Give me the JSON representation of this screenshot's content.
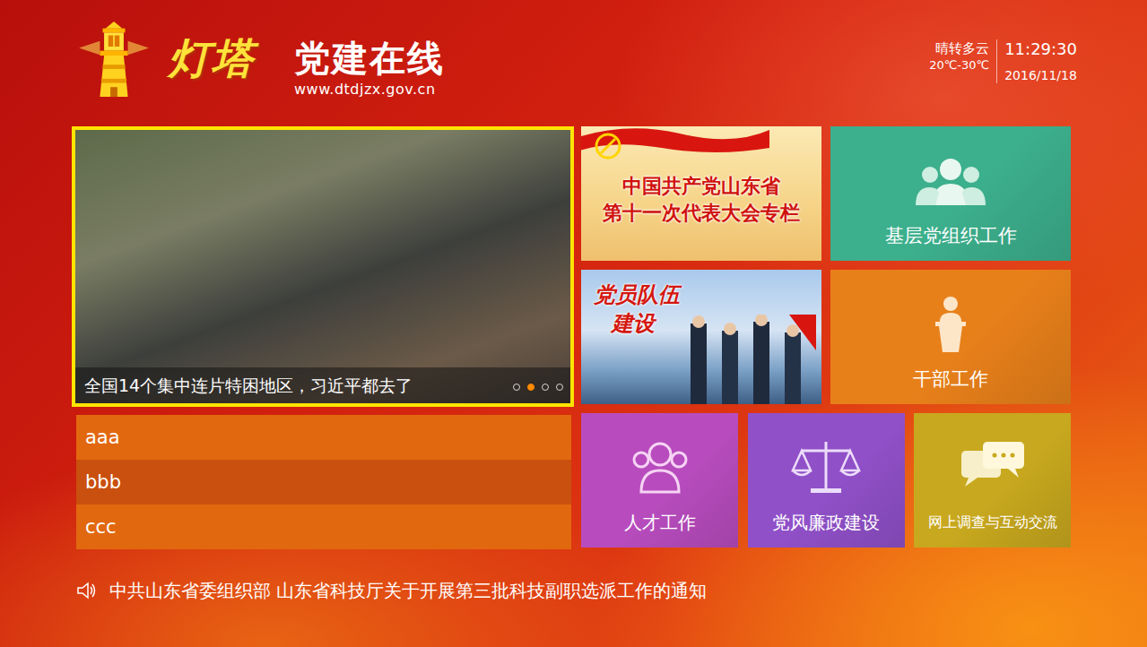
{
  "header": {
    "logo_text": "灯塔",
    "title": "党建在线",
    "url": "www.dtdjzx.gov.cn",
    "weather": "晴转多云",
    "temperature": "20℃-30℃",
    "time": "11:29:30",
    "date": "2016/11/18"
  },
  "carousel": {
    "selected": true,
    "caption": "全国14个集中连片特困地区，习近平都去了",
    "dots": [
      {
        "selected": false
      },
      {
        "selected": true
      },
      {
        "selected": false
      },
      {
        "selected": false
      }
    ]
  },
  "news_list": [
    {
      "title": "aaa"
    },
    {
      "title": "bbb"
    },
    {
      "title": "ccc"
    }
  ],
  "tiles": [
    {
      "kind": "banner",
      "lines": [
        "中国共产党山东省",
        "第十一次代表大会专栏"
      ],
      "selected": false,
      "color": "#f6d58a"
    },
    {
      "kind": "icon",
      "label": "基层党组织工作",
      "selected": false,
      "color": "#3caf8c"
    },
    {
      "kind": "banner",
      "lines": [
        "党员队伍",
        "建设"
      ],
      "selected": false,
      "color": "#a9c9ec"
    },
    {
      "kind": "icon",
      "label": "干部工作",
      "selected": false,
      "color": "#e8801a"
    },
    {
      "kind": "icon",
      "label": "人才工作",
      "selected": false,
      "color": "#b84cbe"
    },
    {
      "kind": "icon",
      "label": "党风廉政建设",
      "selected": false,
      "color": "#9050c8"
    },
    {
      "kind": "icon",
      "label": "网上调查与互动交流",
      "selected": false,
      "color": "#c8a81e"
    }
  ],
  "notice": {
    "text": "中共山东省委组织部 山东省科技厅关于开展第三批科技副职选派工作的通知"
  }
}
